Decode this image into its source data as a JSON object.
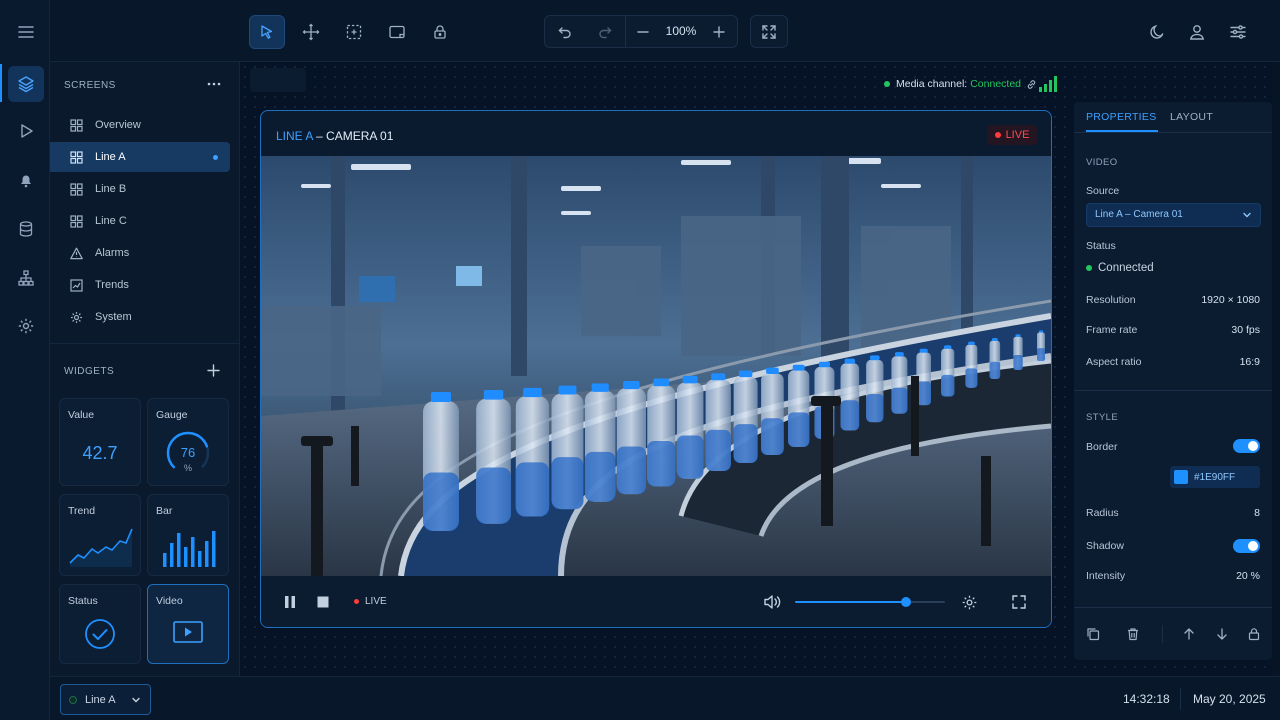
{
  "toolbar": {
    "zoom": "100%"
  },
  "left_panel": {
    "screens_title": "SCREENS",
    "screens": [
      {
        "label": "Overview"
      },
      {
        "label": "Line A"
      },
      {
        "label": "Line B"
      },
      {
        "label": "Line C"
      },
      {
        "label": "Alarms"
      },
      {
        "label": "Trends"
      },
      {
        "label": "System"
      }
    ],
    "active_screen": "Line A",
    "widgets_title": "WIDGETS",
    "widgets": {
      "value": {
        "label": "Value",
        "number": "42.7"
      },
      "gauge": {
        "label": "Gauge",
        "number": "76",
        "unit": "%",
        "level_percent": 76
      },
      "trend": {
        "label": "Trend"
      },
      "bar": {
        "label": "Bar"
      },
      "status": {
        "label": "Status"
      },
      "video": {
        "label": "Video"
      }
    }
  },
  "canvas": {
    "media_channel_label": "Media channel:",
    "media_channel_status": "Connected",
    "video_widget": {
      "title_line": "LINE A",
      "title_rest": " – CAMERA 01",
      "live_badge": "LIVE",
      "controls_live": "LIVE",
      "volume_percent": 74
    }
  },
  "properties": {
    "tabs": [
      "PROPERTIES",
      "LAYOUT"
    ],
    "active_tab": "PROPERTIES",
    "video_section": "VIDEO",
    "source_label": "Source",
    "source_value": "Line A – Camera 01",
    "status_label": "Status",
    "status_value": "Connected",
    "resolution_label": "Resolution",
    "resolution_value": "1920 × 1080",
    "frame_rate_label": "Frame rate",
    "frame_rate_value": "30 fps",
    "aspect_label": "Aspect ratio",
    "aspect_value": "16:9",
    "style_section": "STYLE",
    "border_label": "Border",
    "border_on": true,
    "border_color": "#1E90FF",
    "radius_label": "Radius",
    "radius_value": "8",
    "shadow_label": "Shadow",
    "shadow_on": true,
    "intensity_label": "Intensity",
    "intensity_value": "20 %"
  },
  "bottom_bar": {
    "line_select": "Line A",
    "time": "14:32:18",
    "date": "May 20, 2025"
  },
  "colors": {
    "accent": "#1E90FF",
    "live": "#FF3B3B",
    "connected": "#22C55E",
    "background": "#071426"
  }
}
